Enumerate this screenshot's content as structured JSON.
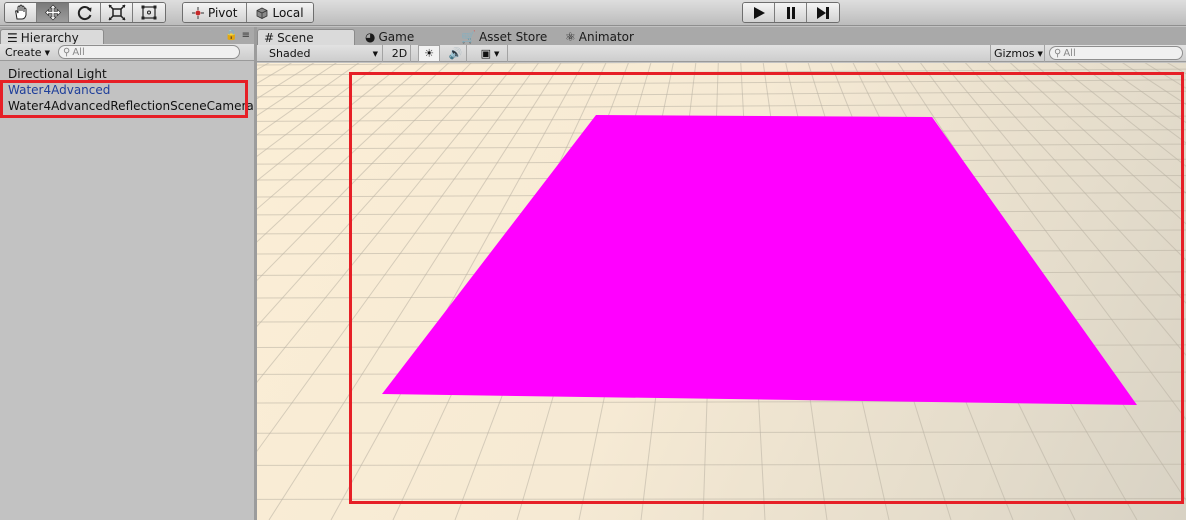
{
  "toolbar": {
    "tools": [
      {
        "icon": "hand-icon",
        "active": false
      },
      {
        "icon": "move-icon",
        "active": true
      },
      {
        "icon": "rotate-icon",
        "active": false
      },
      {
        "icon": "scale-icon",
        "active": false
      },
      {
        "icon": "rect-icon",
        "active": false
      }
    ],
    "pivot_label": "Pivot",
    "local_label": "Local",
    "play_icon": "play-icon",
    "pause_icon": "pause-icon",
    "step_icon": "step-icon"
  },
  "hierarchy": {
    "tab_label": "Hierarchy",
    "create_label": "Create",
    "search_placeholder": "All",
    "items": [
      {
        "label": "Directional Light",
        "prefab": false
      },
      {
        "label": "Water4Advanced",
        "prefab": true
      },
      {
        "label": "Water4AdvancedReflectionSceneCamera",
        "prefab": false
      }
    ]
  },
  "scene": {
    "tabs": {
      "scene": "Scene",
      "game": "Game",
      "asset_store": "Asset Store",
      "animator": "Animator"
    },
    "draw_mode": "Shaded",
    "mode_2d": "2D",
    "gizmos_label": "Gizmos",
    "search_placeholder": "All"
  },
  "colors": {
    "highlight": "#e61f26",
    "plane": "#ff00ff",
    "prefab_text": "#1f3f9a"
  }
}
